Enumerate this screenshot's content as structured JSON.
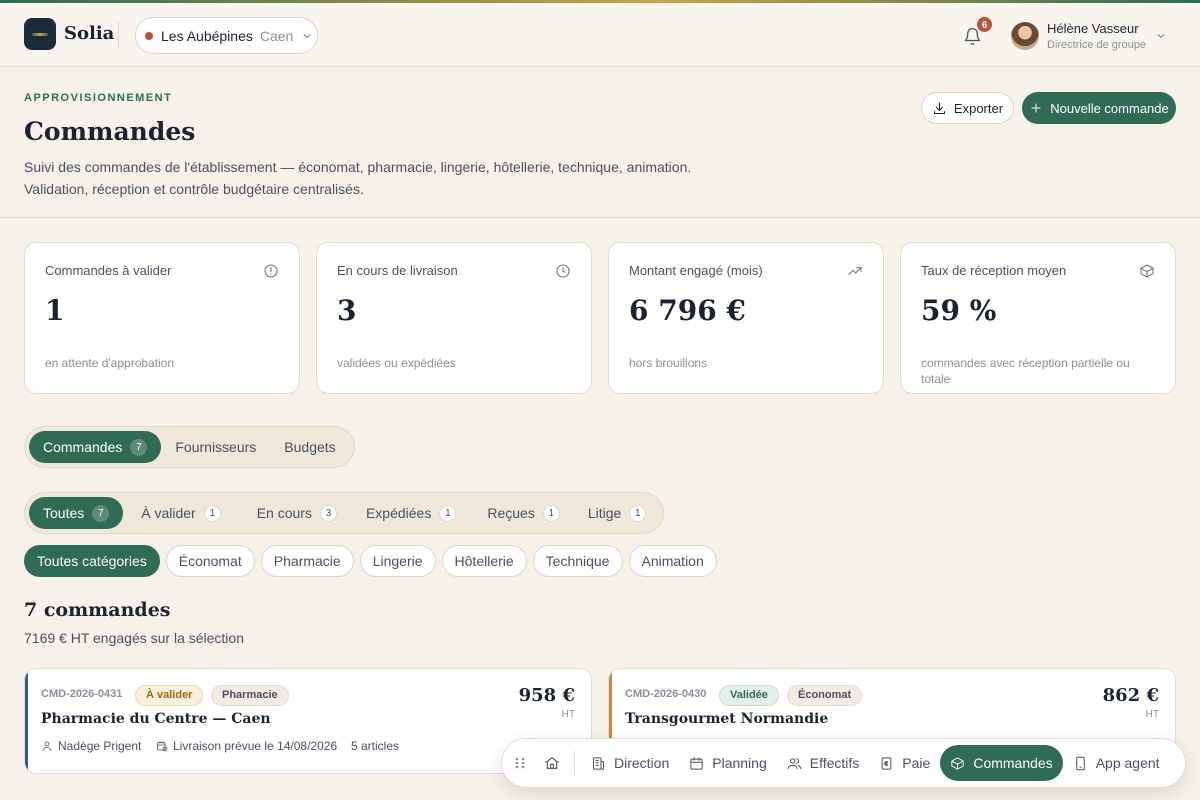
{
  "header": {
    "brand": "Solia",
    "site_name": "Les Aubépines",
    "site_city": "Caen",
    "notification_count": "6",
    "user_name": "Hélène Vasseur",
    "user_role": "Directrice de groupe"
  },
  "page": {
    "eyebrow": "APPROVISIONNEMENT",
    "title": "Commandes",
    "description_line1": "Suivi des commandes de l'établissement — économat, pharmacie, lingerie, hôtellerie, technique, animation.",
    "description_line2": "Validation, réception et contrôle budgétaire centralisés.",
    "export_label": "Exporter",
    "new_label": "Nouvelle commande"
  },
  "kpis": [
    {
      "label": "Commandes à valider",
      "value": "1",
      "sub": "en attente d'approbation",
      "icon": "alert-circle-icon"
    },
    {
      "label": "En cours de livraison",
      "value": "3",
      "sub": "validées ou expédiées",
      "icon": "clock-icon"
    },
    {
      "label": "Montant engagé (mois)",
      "value": "6 796 €",
      "sub": "hors brouillons",
      "icon": "trending-up-icon"
    },
    {
      "label": "Taux de réception moyen",
      "value": "59 %",
      "sub": "commandes avec réception partielle ou totale",
      "icon": "package-icon"
    }
  ],
  "main_tabs": [
    {
      "label": "Commandes",
      "count": "7",
      "active": true
    },
    {
      "label": "Fournisseurs",
      "active": false
    },
    {
      "label": "Budgets",
      "active": false
    }
  ],
  "status_filters": [
    {
      "label": "Toutes",
      "count": "7",
      "active": true
    },
    {
      "label": "À valider",
      "count": "1"
    },
    {
      "label": "En cours",
      "count": "3"
    },
    {
      "label": "Expédiées",
      "count": "1"
    },
    {
      "label": "Reçues",
      "count": "1"
    },
    {
      "label": "Litige",
      "count": "1"
    }
  ],
  "categories": [
    {
      "label": "Toutes catégories",
      "active": true
    },
    {
      "label": "Économat"
    },
    {
      "label": "Pharmacie"
    },
    {
      "label": "Lingerie"
    },
    {
      "label": "Hôtellerie"
    },
    {
      "label": "Technique"
    },
    {
      "label": "Animation"
    }
  ],
  "results": {
    "title": "7 commandes",
    "subtitle": "7169 € HT engagés sur la sélection"
  },
  "orders": [
    {
      "ref": "CMD-2026-0431",
      "status": "À valider",
      "category": "Pharmacie",
      "supplier": "Pharmacie du Centre — Caen",
      "amount": "958 €",
      "unit": "HT",
      "owner": "Nadège Prigent",
      "delivery": "Livraison prévue le 14/08/2026",
      "items": "5 articles",
      "accent": "#2f5f8a"
    },
    {
      "ref": "CMD-2026-0430",
      "status": "Validée",
      "category": "Économat",
      "supplier": "Transgourmet Normandie",
      "amount": "862 €",
      "unit": "HT",
      "accent": "#c98a3a"
    }
  ],
  "dock": [
    {
      "label": "Direction",
      "icon": "building-icon"
    },
    {
      "label": "Planning",
      "icon": "calendar-icon"
    },
    {
      "label": "Effectifs",
      "icon": "users-icon"
    },
    {
      "label": "Paie",
      "icon": "payroll-icon"
    },
    {
      "label": "Commandes",
      "icon": "package-icon",
      "active": true
    },
    {
      "label": "App agent",
      "icon": "smartphone-icon"
    }
  ],
  "colors": {
    "primary": "#2f6b55",
    "background": "#f6f2ea",
    "alert": "#b8533a"
  }
}
